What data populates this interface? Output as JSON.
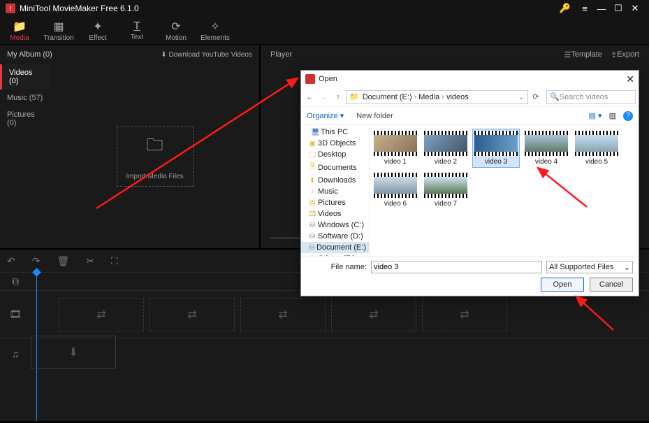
{
  "titlebar": {
    "app": "MiniTool MovieMaker Free 6.1.0"
  },
  "tools": [
    {
      "label": "Media",
      "icon": "📁"
    },
    {
      "label": "Transition",
      "icon": "▦"
    },
    {
      "label": "Effect",
      "icon": "✦"
    },
    {
      "label": "Text",
      "icon": "T̲"
    },
    {
      "label": "Motion",
      "icon": "⟳"
    },
    {
      "label": "Elements",
      "icon": "✧"
    }
  ],
  "album": {
    "title": "My Album (0)",
    "download": "Download YouTube Videos"
  },
  "sidebar": [
    {
      "label": "Videos (0)"
    },
    {
      "label": "Music (57)"
    },
    {
      "label": "Pictures (0)"
    }
  ],
  "import_label": "Import Media Files",
  "player": {
    "title": "Player",
    "template": "Template",
    "export": "Export"
  },
  "dialog": {
    "title": "Open",
    "breadcrumb": [
      "Document (E:)",
      "Media",
      "videos"
    ],
    "search_placeholder": "Search videos",
    "organize": "Organize",
    "newfolder": "New folder",
    "tree": [
      {
        "label": "This PC",
        "cls": "pc",
        "icon": "🖥"
      },
      {
        "label": "3D Objects",
        "cls": "fld",
        "icon": "▣"
      },
      {
        "label": "Desktop",
        "cls": "fld",
        "icon": "🖵"
      },
      {
        "label": "Documents",
        "cls": "fld",
        "icon": "🗎"
      },
      {
        "label": "Downloads",
        "cls": "fld",
        "icon": "⬇"
      },
      {
        "label": "Music",
        "cls": "fld",
        "icon": "♪"
      },
      {
        "label": "Pictures",
        "cls": "fld",
        "icon": "🖼"
      },
      {
        "label": "Videos",
        "cls": "fld",
        "icon": "🎞"
      },
      {
        "label": "Windows (C:)",
        "cls": "drive",
        "icon": "⛁"
      },
      {
        "label": "Software (D:)",
        "cls": "drive",
        "icon": "⛁"
      },
      {
        "label": "Document (E:)",
        "cls": "drive sel",
        "icon": "⛁"
      },
      {
        "label": "Others (F:)",
        "cls": "drive",
        "icon": "⛁"
      }
    ],
    "files": [
      "video 1",
      "video 2",
      "video 3",
      "video 4",
      "video 5",
      "video 6",
      "video 7"
    ],
    "selected": "video 3",
    "thumb_colors": [
      "linear-gradient(135deg,#c7b18a,#8a735a)",
      "linear-gradient(135deg,#7da2c4,#456)",
      "linear-gradient(90deg,#2a5e8e,#6aa0c8)",
      "linear-gradient(180deg,#a8c4d8,#607a68)",
      "linear-gradient(180deg,#c8dff0,#88a4b0)",
      "linear-gradient(180deg,#d0dbe4,#7f97a8)",
      "linear-gradient(180deg,#cfe4f2,#5a7a58)"
    ],
    "filename_label": "File name:",
    "filter": "All Supported Files",
    "open": "Open",
    "cancel": "Cancel"
  }
}
